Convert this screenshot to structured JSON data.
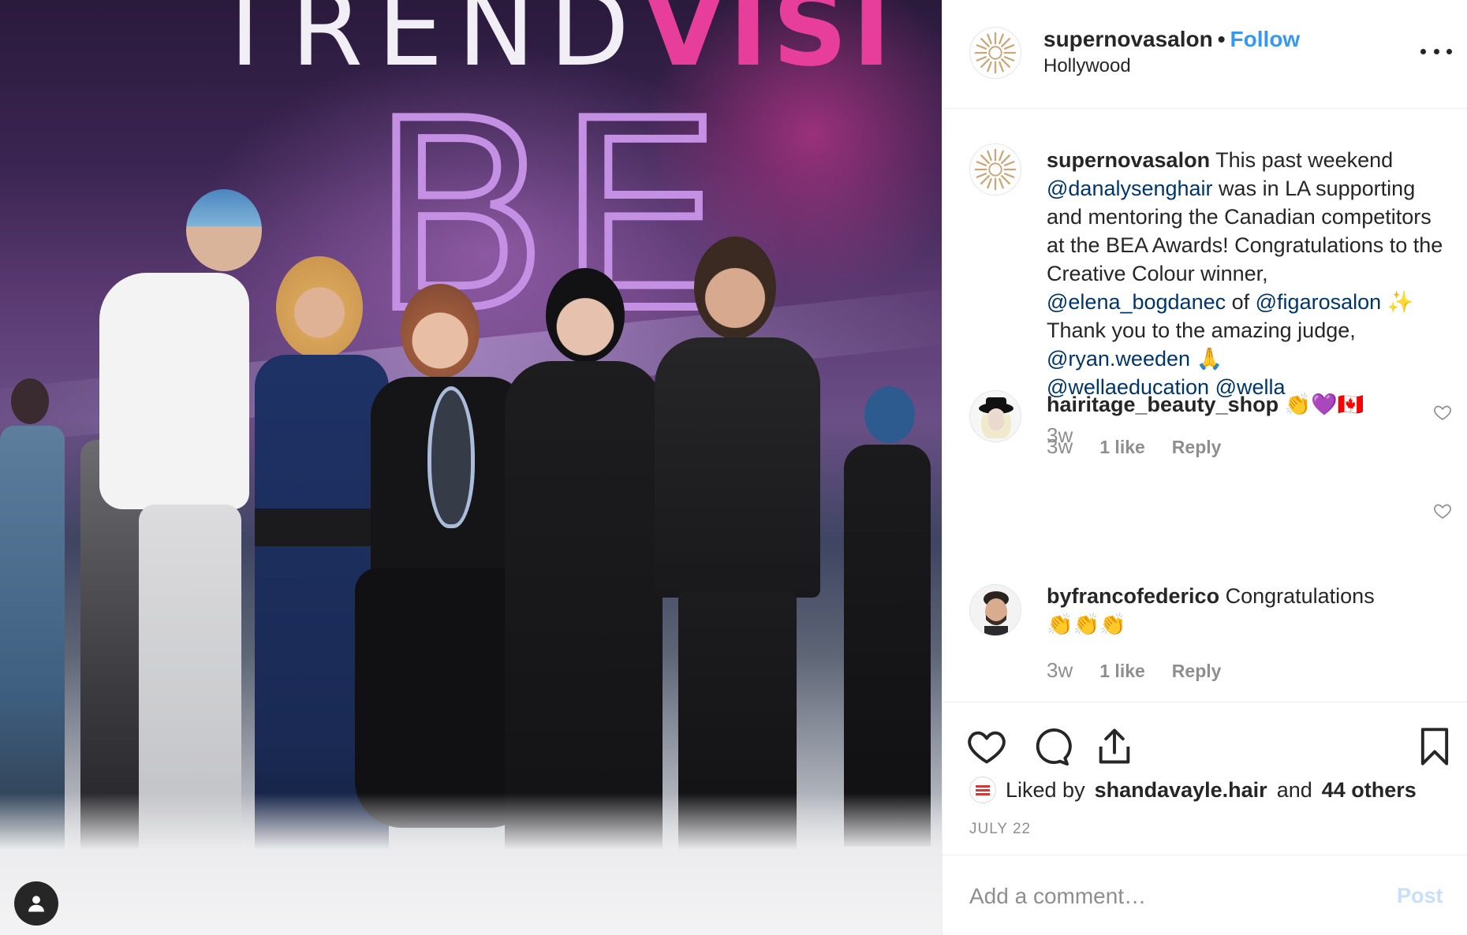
{
  "photo": {
    "stage_text_light": "TREND",
    "stage_text_pink": "VISI",
    "stage_text_bea": "BE"
  },
  "post": {
    "username": "supernovasalon",
    "separator": "•",
    "follow_label": "Follow",
    "location": "Hollywood"
  },
  "caption": {
    "username": "supernovasalon",
    "seg1": " This past weekend ",
    "mention1": "@danalysenghair",
    "seg2": " was in LA supporting and mentoring the Canadian competitors at the BEA Awards! Congratulations to the Creative Colour winner, ",
    "mention2": "@elena_bogdanec",
    "seg3": " of ",
    "mention3": "@figarosalon",
    "sparkle": "✨",
    "seg4": " Thank you to the amazing judge, ",
    "mention4": "@ryan.weeden",
    "pray": "🙏",
    "mention5": "@wellaeducation",
    "mention6": "@wella",
    "age": "3w"
  },
  "comments": [
    {
      "username": "hairitage_beauty_shop",
      "emoji": "👏💜🇨🇦",
      "age": "3w",
      "likes": "1 like",
      "reply": "Reply"
    },
    {
      "username": "byfrancofederico",
      "text": "Congratulations",
      "emoji": "👏👏👏",
      "age": "3w",
      "likes": "1 like",
      "reply": "Reply"
    }
  ],
  "likes": {
    "prefix": "Liked by",
    "user": "shandavayle.hair",
    "and": "and",
    "others": "44 others"
  },
  "date": "JULY 22",
  "add_comment": {
    "placeholder": "Add a comment…",
    "post_label": "Post"
  },
  "colors": {
    "link_blue": "#3897f0",
    "mention_navy": "#003569",
    "muted": "#8e8e8e",
    "post_disabled": "#c7dffa"
  },
  "icons": [
    "user-tag-icon",
    "heart-icon",
    "comment-icon",
    "share-icon",
    "bookmark-icon",
    "more-icon",
    "sunburst-logo-icon"
  ]
}
